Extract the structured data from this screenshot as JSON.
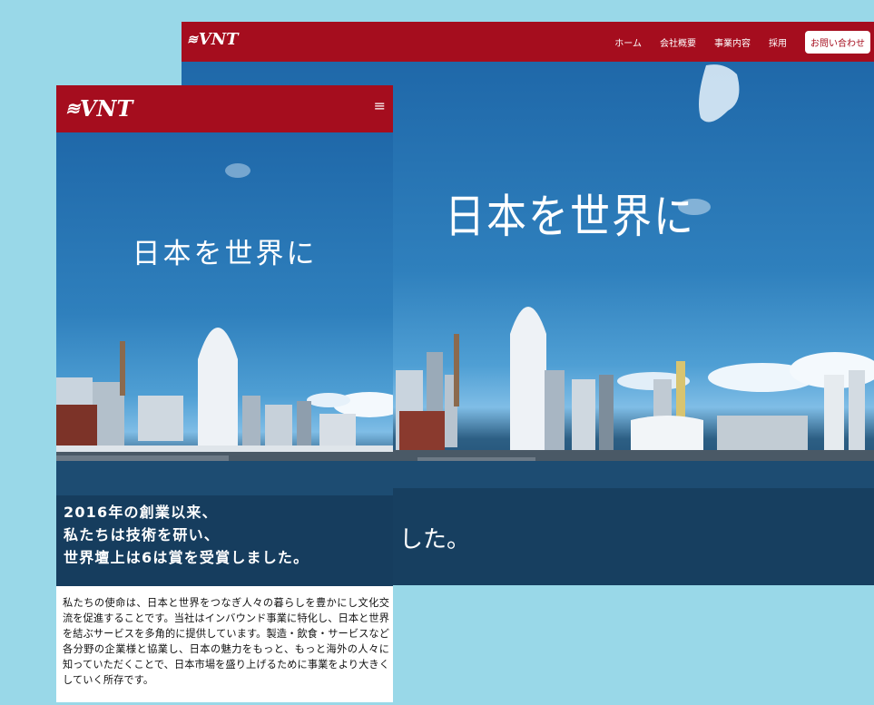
{
  "brand": {
    "logo_text": "VNT",
    "logo_mark": "≋"
  },
  "desktop": {
    "nav": [
      "ホーム",
      "会社概要",
      "事業内容",
      "採用"
    ],
    "contact_label": "お問い合わせ",
    "hero_title": "日本を世界に",
    "hero_tail": "した。"
  },
  "mobile": {
    "menu_icon": "≡",
    "hero_title": "日本を世界に",
    "lead": [
      "2016年の創業以来、",
      "私たちは技術を研い、",
      "世界壇上は6は賞を受賞しました。"
    ],
    "body": "私たちの使命は、日本と世界をつなぎ人々の暮らしを豊かにし文化交流を促進することです。当社はインバウンド事業に特化し、日本と世界を結ぶサービスを多角的に提供しています。製造・飲食・サービスなど各分野の企業様と協業し、日本の魅力をもっと、もっと海外の人々に知っていただくことで、日本市場を盛り上げるために事業をより大きくしていく所存です。"
  },
  "colors": {
    "brand_red": "#a50d1e",
    "page_bg": "#99d8e8",
    "sky_blue": "#1f68a9",
    "sea": "#1d4c72"
  }
}
